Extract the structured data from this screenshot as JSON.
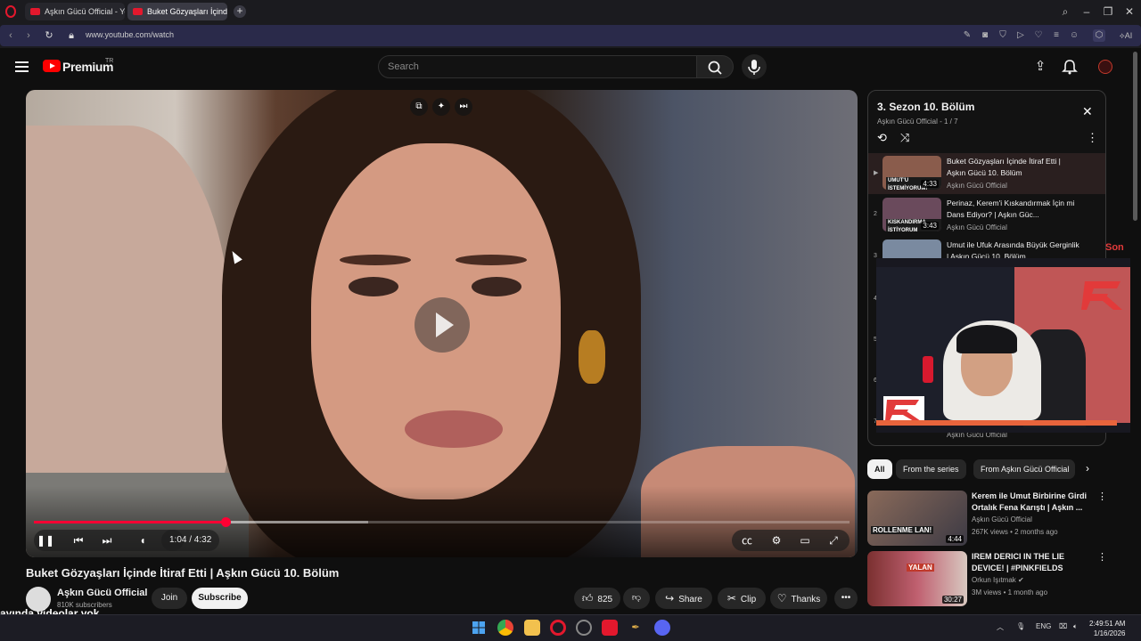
{
  "browser": {
    "tabs": [
      {
        "label": "Aşkın Gücü Official - YouT"
      },
      {
        "label": "Buket Gözyaşları İçinde"
      }
    ],
    "new_tab_icon": "plus-icon",
    "url": "www.youtube.com/watch",
    "ai_label": "AI"
  },
  "header": {
    "brand": "Premium",
    "region": "TR",
    "search_placeholder": "Search"
  },
  "player": {
    "current_time": "1:04 / 4:32",
    "progress_fraction": 0.235,
    "buffered_fraction": 0.41
  },
  "video": {
    "title": "Buket Gözyaşları İçinde İtiraf Etti | Aşkın Gücü 10. Bölüm",
    "channel": "Aşkın Gücü Official",
    "subscribers": "810K subscribers",
    "join_label": "Join",
    "subscribe_label": "Subscribe",
    "likes": "825",
    "share_label": "Share",
    "clip_label": "Clip",
    "thanks_label": "Thanks"
  },
  "overlay_caption": "ayında videolar yok",
  "playlist": {
    "title": "3. Sezon 10. Bölüm",
    "subtitle": "Aşkın Gücü Official - 1 / 7",
    "items": [
      {
        "index": "▶",
        "title": "Buket Gözyaşları İçinde İtiraf Etti | Aşkın Gücü 10. Bölüm",
        "channel": "Aşkın Gücü Official",
        "duration": "4:33",
        "thumb_text": "UMUT'U İSTEMİYORUM!"
      },
      {
        "index": "2",
        "title": "Perinaz, Kerem'i Kıskandırmak İçin mi Dans Ediyor? | Aşkın Güc...",
        "channel": "Aşkın Gücü Official",
        "duration": "3:43",
        "thumb_text": "KISKANDIRMA İSTİYORUM"
      },
      {
        "index": "3",
        "title": "Umut ile Ufuk Arasında Büyük Gerginlik | Aşkın Gücü 10. Bölüm",
        "channel": "",
        "duration": "",
        "thumb_text": ""
      },
      {
        "index": "4",
        "title": "",
        "channel": "",
        "duration": "",
        "thumb_text": ""
      },
      {
        "index": "5",
        "title": "",
        "channel": "",
        "duration": "",
        "thumb_text": ""
      },
      {
        "index": "6",
        "title": "",
        "channel": "",
        "duration": "",
        "thumb_text": ""
      },
      {
        "index": "7",
        "title": "",
        "channel": "Aşkın Gücü Official",
        "duration": "",
        "thumb_text": ""
      }
    ]
  },
  "webcam": {
    "side_text": "Son"
  },
  "chips": [
    "All",
    "From the series",
    "From Aşkın Gücü Official"
  ],
  "recommendations": [
    {
      "title": "Kerem ile Umut Birbirine Girdi Ortalık Fena Karıştı | Aşkın ...",
      "channel": "Aşkın Gücü Official",
      "meta": "267K views • 2 months ago",
      "duration": "4:44",
      "thumb_text": "ROLLENME LAN!"
    },
    {
      "title": "IREM DERICI IN THE LIE DEVICE! | #PINKFIELDS",
      "channel": "Orkun Işıtmak",
      "meta": "3M views • 1 month ago",
      "duration": "30:27",
      "thumb_text": "YALAN"
    }
  ],
  "taskbar": {
    "lang": "ENG",
    "time": "2:49:51 AM",
    "date": "1/16/2026"
  },
  "colors": {
    "accent_red": "#ff0033",
    "bg": "#0f0f0f",
    "address_bar": "#2a2a4a"
  }
}
